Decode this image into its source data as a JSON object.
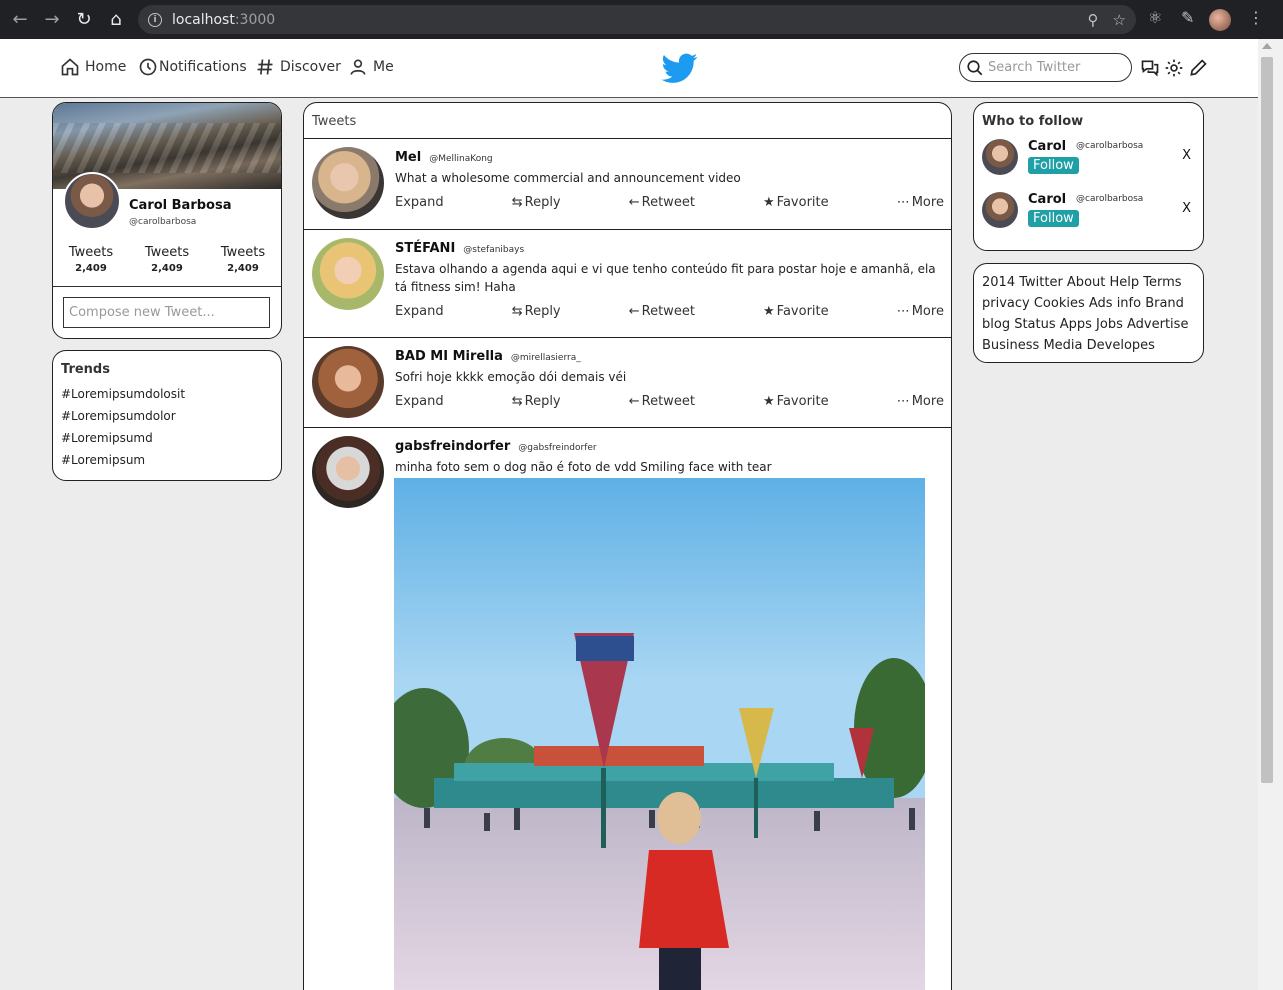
{
  "browser": {
    "url_host": "localhost",
    "url_port": ":3000"
  },
  "nav": {
    "home": "Home",
    "notifications": "Notifications",
    "discover": "Discover",
    "me": "Me",
    "search_placeholder": "Search Twitter"
  },
  "profile": {
    "name": "Carol Barbosa",
    "handle": "@carolbarbosa",
    "stats": [
      {
        "label": "Tweets",
        "value": "2,409"
      },
      {
        "label": "Tweets",
        "value": "2,409"
      },
      {
        "label": "Tweets",
        "value": "2,409"
      }
    ],
    "compose_placeholder": "Compose new Tweet..."
  },
  "trends": {
    "title": "Trends",
    "items": [
      "#Loremipsumdolosit",
      "#Loremipsumdolor",
      "#Loremipsumd",
      "#Loremipsum"
    ]
  },
  "feed": {
    "title": "Tweets",
    "actions": {
      "expand": "Expand",
      "reply": "Reply",
      "retweet": "Retweet",
      "favorite": "Favorite",
      "more": "More"
    },
    "tweets": [
      {
        "name": "Mel",
        "handle": "@MellinaKong",
        "text": "What a wholesome commercial and announcement video"
      },
      {
        "name": "STÉFANI",
        "handle": "@stefanibays",
        "text": "Estava olhando a agenda aqui e vi que tenho conteúdo fit para postar hoje e amanhã, ela tá fitness sim! Haha"
      },
      {
        "name": "BAD MI Mirella",
        "handle": "@mirellasierra_",
        "text": "Sofri hoje kkkk emoção dói demais véi"
      },
      {
        "name": "gabsfreindorfer",
        "handle": "@gabsfreindorfer",
        "text": "minha foto sem o dog não é foto de vdd Smiling face with tear"
      }
    ]
  },
  "who_to_follow": {
    "title": "Who to follow",
    "follow_label": "Follow",
    "close_label": "X",
    "users": [
      {
        "name": "Carol",
        "handle": "@carolbarbosa"
      },
      {
        "name": "Carol",
        "handle": "@carolbarbosa"
      }
    ]
  },
  "footer": {
    "text": "2014 Twitter About Help Terms privacy Cookies Ads info Brand blog Status Apps Jobs Advertise Business Media Developes"
  },
  "colors": {
    "brand_blue": "#1d9bf0",
    "follow_teal": "#1fa0a6"
  }
}
